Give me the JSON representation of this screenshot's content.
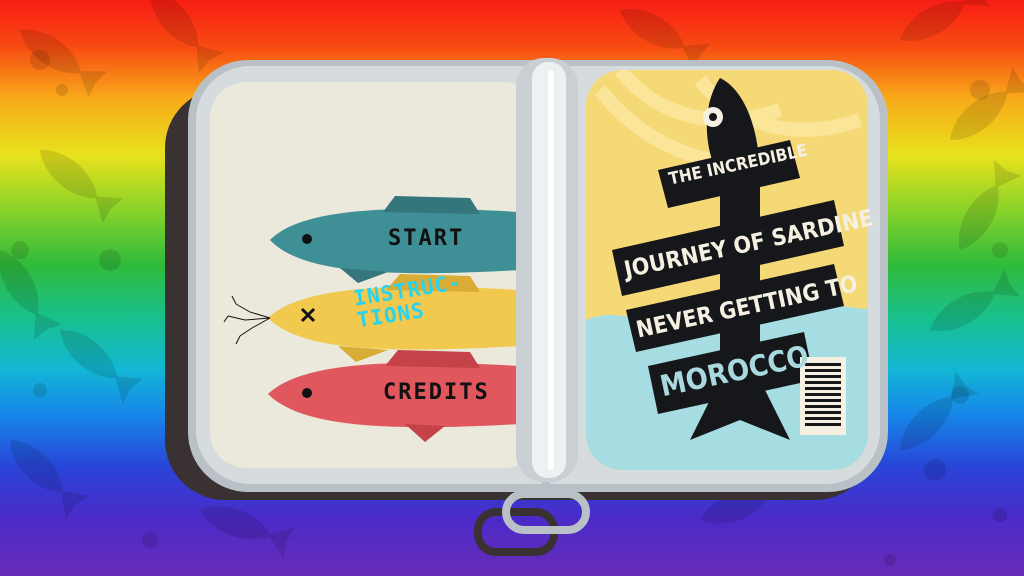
{
  "menu": {
    "start_label": "START",
    "instructions_label": "INSTRUC-\nTIONS",
    "credits_label": "CREDITS"
  },
  "label": {
    "line1": "THE INCREDIBLE",
    "line2": "JOURNEY OF SARDINE",
    "line3": "NEVER GETTING TO",
    "line4": "MOROCCO"
  },
  "colors": {
    "fish_start": "#3f8f96",
    "fish_instructions": "#f2c94f",
    "fish_credits": "#e0575d",
    "instructions_text": "#27d3ee",
    "label_yellow": "#f6d977",
    "label_water": "#a6dde3"
  },
  "icons": [
    "fish-silhouette-icon",
    "barcode-icon",
    "x-eye-icon",
    "can-key-icon"
  ]
}
